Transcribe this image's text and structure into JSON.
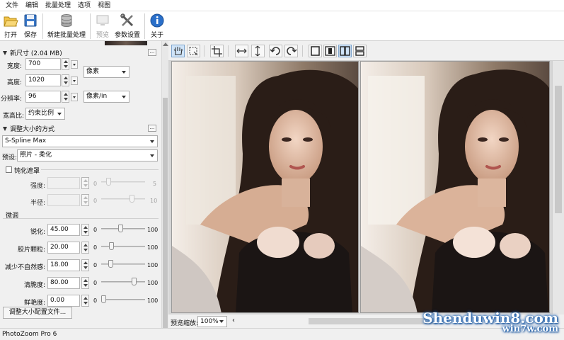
{
  "menu": [
    "文件",
    "编辑",
    "批量处理",
    "选项",
    "视图"
  ],
  "toolbar": {
    "open": "打开",
    "save": "保存",
    "batch": "新建批量处理",
    "preview": "预览",
    "settings": "参数设置",
    "about": "关于"
  },
  "new_size": {
    "header": "新尺寸 (2.04 MB)",
    "width_label": "宽度:",
    "width_value": "700",
    "height_label": "高度:",
    "height_value": "1020",
    "resolution_label": "分辨率:",
    "resolution_value": "96",
    "unit_size": "像素",
    "unit_res": "像素/in",
    "aspect_label": "宽高比:",
    "aspect_value": "约束比例",
    "more": "..."
  },
  "resize_method": {
    "header": "调整大小的方式",
    "method": "S-Spline Max",
    "preset_label": "预设:",
    "preset_value": "照片 - 柔化",
    "unsharp_label": "钝化遮罩",
    "strength_label": "强度:",
    "radius_label": "半径:",
    "zero": "0",
    "strength_max": "5",
    "radius_max": "10"
  },
  "finetune": {
    "header": "微调",
    "rows": [
      {
        "label": "锐化:",
        "value": "45.00",
        "min": "0",
        "max": "100",
        "level": 0.45
      },
      {
        "label": "胶片颗粒:",
        "value": "20.00",
        "min": "0",
        "max": "100",
        "level": 0.2
      },
      {
        "label": "减少不自然感:",
        "value": "18.00",
        "min": "0",
        "max": "100",
        "level": 0.18
      },
      {
        "label": "清脆度:",
        "value": "80.00",
        "min": "0",
        "max": "100",
        "level": 0.8
      },
      {
        "label": "鲜艳度:",
        "value": "0.00",
        "min": "0",
        "max": "100",
        "level": 0.0
      }
    ],
    "profile_button": "调整大小配置文件..."
  },
  "preview": {
    "zoom_label": "预览缩放:",
    "zoom_value": "100%"
  },
  "status": "PhotoZoom Pro 6",
  "watermark": {
    "line1": "Shenduwin8.com",
    "line2": "win7w.com"
  }
}
